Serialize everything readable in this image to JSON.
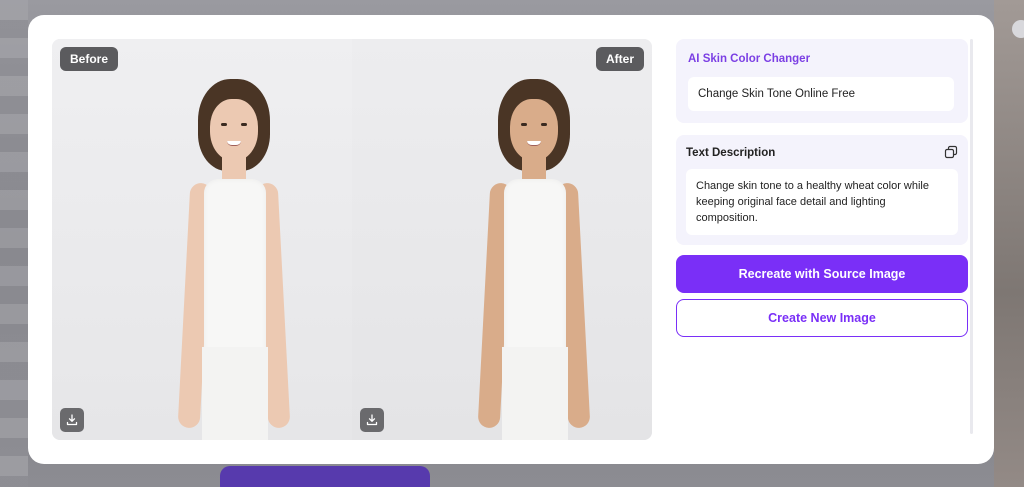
{
  "compare": {
    "before_label": "Before",
    "after_label": "After"
  },
  "tool_card": {
    "title": "AI Skin Color Changer",
    "value": "Change Skin Tone Online Free"
  },
  "description": {
    "label": "Text Description",
    "text": "Change skin tone to a healthy wheat color while keeping original face detail and lighting composition."
  },
  "actions": {
    "recreate_label": "Recreate with Source Image",
    "create_label": "Create New Image"
  },
  "colors": {
    "accent": "#7a2ff7",
    "accent_text": "#7b3fe4",
    "card_bg": "#f4f3fc",
    "badge_bg": "#5b5b5e"
  },
  "icons": {
    "download": "download-icon",
    "copy": "copy-icon"
  }
}
